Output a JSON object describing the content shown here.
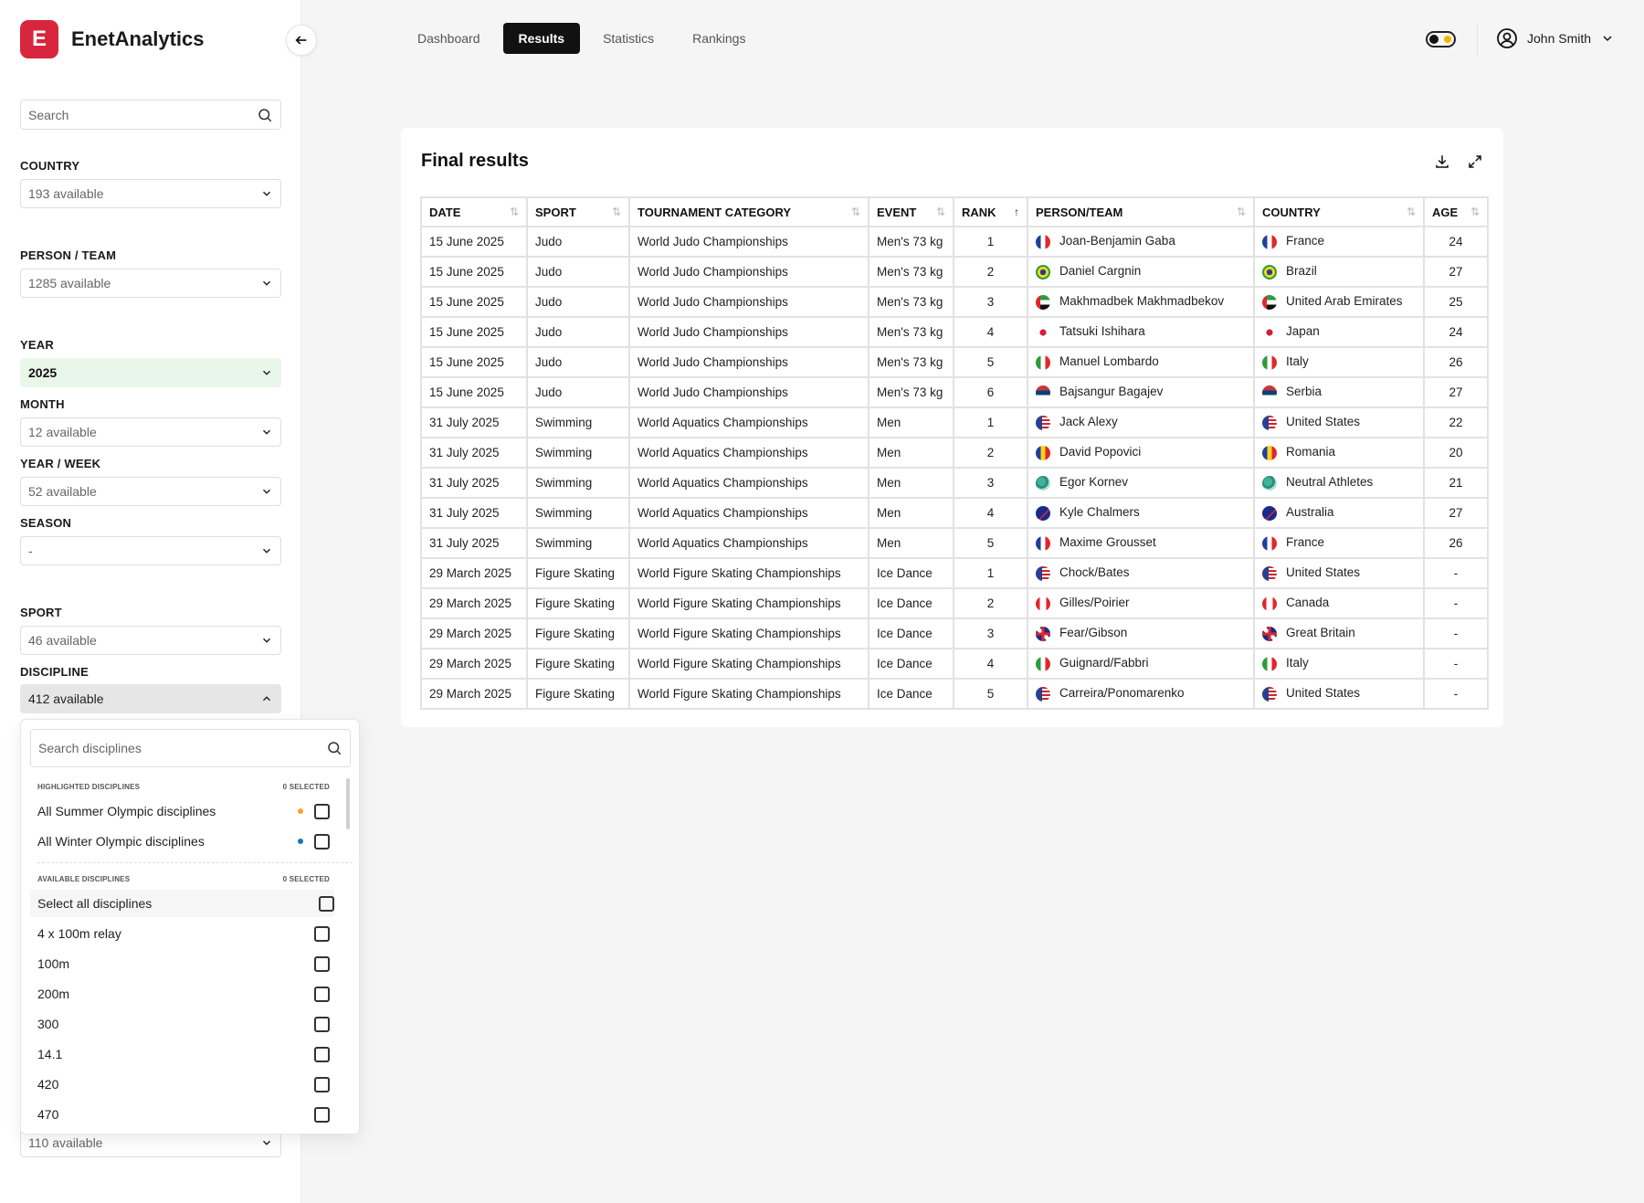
{
  "app": {
    "name": "EnetAnalytics",
    "logo_letter": "E"
  },
  "sidebar": {
    "search_placeholder": "Search",
    "filters": {
      "country": {
        "label": "COUNTRY",
        "value": "193 available"
      },
      "person_team": {
        "label": "PERSON / TEAM",
        "value": "1285 available"
      },
      "year": {
        "label": "YEAR",
        "value": "2025"
      },
      "month": {
        "label": "MONTH",
        "value": "12 available"
      },
      "year_week": {
        "label": "YEAR / WEEK",
        "value": "52 available"
      },
      "season": {
        "label": "SEASON",
        "value": "-"
      },
      "sport": {
        "label": "SPORT",
        "value": "46 available"
      },
      "discipline": {
        "label": "DISCIPLINE",
        "value": "412 available"
      },
      "below": {
        "value": "110 available"
      }
    }
  },
  "discipline_dropdown": {
    "search_placeholder": "Search disciplines",
    "highlighted": {
      "label": "HIGHLIGHTED DISCIPLINES",
      "selected": "0 SELECTED",
      "items": [
        "All Summer Olympic disciplines",
        "All Winter Olympic disciplines"
      ]
    },
    "available": {
      "label": "AVAILABLE DISCIPLINES",
      "selected": "0 SELECTED",
      "items": [
        "Select all disciplines",
        "4 x 100m relay",
        "100m",
        "200m",
        "300",
        "14.1",
        "420",
        "470"
      ]
    },
    "dot_colors": [
      "#f5a623",
      "#1a73b5"
    ]
  },
  "nav": {
    "tabs": [
      "Dashboard",
      "Results",
      "Statistics",
      "Rankings"
    ],
    "active": "Results"
  },
  "user": {
    "name": "John Smith"
  },
  "results": {
    "title": "Final results",
    "columns": [
      "DATE",
      "SPORT",
      "TOURNAMENT CATEGORY",
      "EVENT",
      "RANK",
      "PERSON/TEAM",
      "COUNTRY",
      "AGE"
    ],
    "rows": [
      [
        "15 June 2025",
        "Judo",
        "World Judo Championships",
        "Men's 73 kg",
        "1",
        "Joan-Benjamin Gaba",
        "France",
        "24"
      ],
      [
        "15 June 2025",
        "Judo",
        "World Judo Championships",
        "Men's 73 kg",
        "2",
        "Daniel Cargnin",
        "Brazil",
        "27"
      ],
      [
        "15 June 2025",
        "Judo",
        "World Judo Championships",
        "Men's 73 kg",
        "3",
        "Makhmadbek Makhmadbekov",
        "United Arab Emirates",
        "25"
      ],
      [
        "15 June 2025",
        "Judo",
        "World Judo Championships",
        "Men's 73 kg",
        "4",
        "Tatsuki Ishihara",
        "Japan",
        "24"
      ],
      [
        "15 June 2025",
        "Judo",
        "World Judo Championships",
        "Men's 73 kg",
        "5",
        "Manuel Lombardo",
        "Italy",
        "26"
      ],
      [
        "15 June 2025",
        "Judo",
        "World Judo Championships",
        "Men's 73 kg",
        "6",
        "Bajsangur Bagajev",
        "Serbia",
        "27"
      ],
      [
        "31 July 2025",
        "Swimming",
        "World Aquatics Championships",
        "Men",
        "1",
        "Jack Alexy",
        "United States",
        "22"
      ],
      [
        "31 July 2025",
        "Swimming",
        "World Aquatics Championships",
        "Men",
        "2",
        "David Popovici",
        "Romania",
        "20"
      ],
      [
        "31 July 2025",
        "Swimming",
        "World Aquatics Championships",
        "Men",
        "3",
        "Egor Kornev",
        "Neutral Athletes",
        "21"
      ],
      [
        "31 July 2025",
        "Swimming",
        "World Aquatics Championships",
        "Men",
        "4",
        "Kyle Chalmers",
        "Australia",
        "27"
      ],
      [
        "31 July 2025",
        "Swimming",
        "World Aquatics Championships",
        "Men",
        "5",
        "Maxime Grousset",
        "France",
        "26"
      ],
      [
        "29 March 2025",
        "Figure Skating",
        "World Figure Skating Championships",
        "Ice Dance",
        "1",
        "Chock/Bates",
        "United States",
        "-"
      ],
      [
        "29 March 2025",
        "Figure Skating",
        "World Figure Skating Championships",
        "Ice Dance",
        "2",
        "Gilles/Poirier",
        "Canada",
        "-"
      ],
      [
        "29 March 2025",
        "Figure Skating",
        "World Figure Skating Championships",
        "Ice Dance",
        "3",
        "Fear/Gibson",
        "Great Britain",
        "-"
      ],
      [
        "29 March 2025",
        "Figure Skating",
        "World Figure Skating Championships",
        "Ice Dance",
        "4",
        "Guignard/Fabbri",
        "Italy",
        "-"
      ],
      [
        "29 March 2025",
        "Figure Skating",
        "World Figure Skating Championships",
        "Ice Dance",
        "5",
        "Carreira/Ponomarenko",
        "United States",
        "-"
      ]
    ]
  },
  "flags": {
    "France": "linear-gradient(90deg,#1f3f9a 33%,#fff 33% 66%,#e2262a 66%)",
    "Brazil": "radial-gradient(circle,#1f3f9a 28%,#f7d51d 29% 52%,#2d9a3b 53%)",
    "United Arab Emirates": "linear-gradient(90deg,#e2262a 30%,transparent 30%),linear-gradient(180deg,#2d9a3b 33%,#fff 33% 66%,#111 66%)",
    "Japan": "radial-gradient(circle,#d21f35 30%,#fff 32%)",
    "Italy": "linear-gradient(90deg,#2d9a3b 33%,#fff 33% 66%,#e2262a 66%)",
    "Serbia": "linear-gradient(180deg,#c6363c 33%,#0c4076 33% 66%,#fff 66%)",
    "United States": "linear-gradient(90deg,#2a3f8f 45%,transparent 45%),repeating-linear-gradient(180deg,#c8282f 0 2px,#fff 2px 4px)",
    "Romania": "linear-gradient(90deg,#1f3f9a 33%,#f7d51d 33% 66%,#e2262a 66%)",
    "Neutral Athletes": "radial-gradient(circle at 40% 40%,#3fb39a 35%,#2a8c7a 36% 55%,#a8e0d2 56%)",
    "Australia": "linear-gradient(135deg,#1a2a8c 55%,#e2262a 55% 62%,#1a2a8c 62%)",
    "Canada": "linear-gradient(90deg,#e2262a 28%,#fff 28% 72%,#e2262a 72%)",
    "Great Britain": "linear-gradient(90deg,transparent 42%,#e2262a 42% 58%,transparent 58%),linear-gradient(180deg,transparent 42%,#e2262a 42% 58%,transparent 58%),linear-gradient(45deg,#1a2a8c 40%,#fff 40% 60%,#1a2a8c 60%)"
  },
  "person_flags": {
    "Joan-Benjamin Gaba": "France",
    "Daniel Cargnin": "Brazil",
    "Makhmadbek Makhmadbekov": "United Arab Emirates",
    "Tatsuki Ishihara": "Japan",
    "Manuel Lombardo": "Italy",
    "Bajsangur Bagajev": "Serbia",
    "Jack Alexy": "United States",
    "David Popovici": "Romania",
    "Egor Kornev": "Neutral Athletes",
    "Kyle Chalmers": "Australia",
    "Maxime Grousset": "France",
    "Chock/Bates": "United States",
    "Gilles/Poirier": "Canada",
    "Fear/Gibson": "Great Britain",
    "Guignard/Fabbri": "Italy",
    "Carreira/Ponomarenko": "United States"
  },
  "colors": {
    "brand": "#d7263d",
    "year_active_bg": "#e9f6ea"
  }
}
